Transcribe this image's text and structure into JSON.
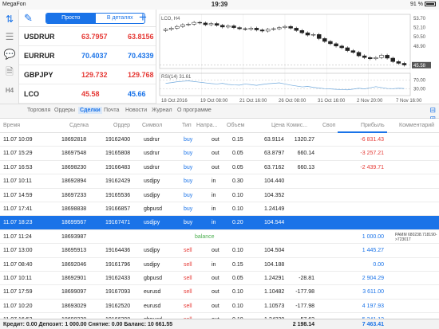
{
  "status": {
    "carrier": "MegaFon",
    "time": "19:39",
    "battery": "91 %"
  },
  "quotes": {
    "tab_simple": "Просто",
    "tab_detailed": "В деталях",
    "items": [
      {
        "symbol": "USDRUR",
        "bid": "63.7957",
        "ask": "63.8156",
        "bid_color": "#e53935",
        "ask_color": "#e53935"
      },
      {
        "symbol": "EURRUR",
        "bid": "70.4037",
        "ask": "70.4339",
        "bid_color": "#1a73e8",
        "ask_color": "#1a73e8"
      },
      {
        "symbol": "GBPJPY",
        "bid": "129.732",
        "ask": "129.768",
        "bid_color": "#e53935",
        "ask_color": "#e53935"
      },
      {
        "symbol": "LCO",
        "bid": "45.58",
        "ask": "45.66",
        "bid_color": "#e53935",
        "ask_color": "#1a73e8"
      }
    ]
  },
  "chart": {
    "title": "LCO, H4",
    "rsi_label": "RSI(14) 31.61",
    "price_ticks": [
      "53.70",
      "52.10",
      "50.50",
      "48.90"
    ],
    "current_price": "45.58",
    "rsi_ticks": [
      "70.00",
      "30.00"
    ],
    "time_ticks": [
      "18 Oct 2016",
      "19 Oct 08:00",
      "21 Oct 16:00",
      "26 Oct 08:00",
      "31 Oct 16:00",
      "2 Nov 20:00",
      "7 Nov 16:00"
    ]
  },
  "chart_data": {
    "type": "candlestick",
    "title": "LCO, H4",
    "close": [
      51.8,
      52.0,
      52.3,
      52.6,
      52.7,
      53.0,
      52.9,
      52.6,
      52.8,
      52.5,
      52.2,
      52.4,
      52.1,
      51.9,
      51.8,
      52.0,
      51.7,
      51.5,
      51.8,
      51.9,
      52.1,
      52.3,
      52.0,
      51.6,
      51.2,
      50.8,
      50.9,
      50.2,
      49.7,
      49.3,
      48.9,
      48.6,
      48.1,
      47.8,
      47.2,
      46.9,
      46.7,
      46.9,
      47.3,
      46.8,
      46.2,
      45.9,
      45.6
    ],
    "rsi": [
      55,
      58,
      62,
      64,
      66,
      63,
      60,
      57,
      54,
      52,
      55,
      50,
      48,
      47,
      52,
      49,
      46,
      50,
      53,
      55,
      57,
      52,
      47,
      43,
      39,
      41,
      37,
      34,
      31,
      30,
      28,
      27,
      26,
      29,
      33,
      30,
      35,
      40,
      36,
      32,
      31,
      33,
      31.6
    ],
    "y_ticks": [
      53.7,
      52.1,
      50.5,
      48.9
    ],
    "rsi_ticks": [
      70,
      30
    ]
  },
  "tabs": [
    "Торговля",
    "Ордеры",
    "Сделки",
    "Почта",
    "Новости",
    "Журнал",
    "О программе"
  ],
  "columns": [
    "Время",
    "Сделка",
    "Ордер",
    "Символ",
    "Тип",
    "Напра...",
    "Объем",
    "Цена",
    "Комис...",
    "Своп",
    "Прибыль",
    "Комментарий"
  ],
  "deals": [
    {
      "time": "11.07 10:09",
      "deal": "18692818",
      "order": "19162400",
      "symbol": "usdrur",
      "type": "buy",
      "dir": "out",
      "volume": "0.15",
      "price": "63.9114",
      "swap": "1320.27",
      "profit": "-6 831.43",
      "profit_class": "neg",
      "comment": ""
    },
    {
      "time": "11.07 15:29",
      "deal": "18697548",
      "order": "19165808",
      "symbol": "usdrur",
      "type": "buy",
      "dir": "out",
      "volume": "0.05",
      "price": "63.8797",
      "swap": "660.14",
      "profit": "-3 257.21",
      "profit_class": "neg",
      "comment": ""
    },
    {
      "time": "11.07 16:53",
      "deal": "18698230",
      "order": "19166483",
      "symbol": "usdrur",
      "type": "buy",
      "dir": "out",
      "volume": "0.05",
      "price": "63.7162",
      "swap": "660.13",
      "profit": "-2 439.71",
      "profit_class": "neg",
      "comment": ""
    },
    {
      "time": "11.07 10:11",
      "deal": "18692894",
      "order": "19162429",
      "symbol": "usdjpy",
      "type": "buy",
      "dir": "in",
      "volume": "0.30",
      "price": "104.440",
      "swap": "",
      "profit": "",
      "profit_class": "",
      "comment": ""
    },
    {
      "time": "11.07 14:59",
      "deal": "18697233",
      "order": "19165536",
      "symbol": "usdjpy",
      "type": "buy",
      "dir": "in",
      "volume": "0.10",
      "price": "104.352",
      "swap": "",
      "profit": "",
      "profit_class": "",
      "comment": ""
    },
    {
      "time": "11.07 17:41",
      "deal": "18698838",
      "order": "19166857",
      "symbol": "gbpusd",
      "type": "buy",
      "dir": "in",
      "volume": "0.10",
      "price": "1.24149",
      "swap": "",
      "profit": "",
      "profit_class": "",
      "comment": ""
    },
    {
      "time": "11.07 18:23",
      "deal": "18699567",
      "order": "19167471",
      "symbol": "usdjpy",
      "type": "buy",
      "dir": "in",
      "volume": "0.20",
      "price": "104.544",
      "swap": "",
      "profit": "",
      "profit_class": "",
      "comment": "",
      "selected": true
    },
    {
      "time": "11.07 11:24",
      "deal": "18693987",
      "order": "",
      "symbol": "",
      "type": "balance",
      "dir": "",
      "volume": "",
      "price": "",
      "swap": "",
      "profit": "1 000.00",
      "profit_class": "pos",
      "comment": "PAMM 680238.718190->723017"
    },
    {
      "time": "11.07 13:00",
      "deal": "18695913",
      "order": "19164436",
      "symbol": "usdjpy",
      "type": "sell",
      "dir": "out",
      "volume": "0.10",
      "price": "104.504",
      "swap": "",
      "profit": "1 445.27",
      "profit_class": "pos",
      "comment": ""
    },
    {
      "time": "11.07 08:40",
      "deal": "18692046",
      "order": "19161796",
      "symbol": "usdjpy",
      "type": "sell",
      "dir": "in",
      "volume": "0.15",
      "price": "104.188",
      "swap": "",
      "profit": "0.00",
      "profit_class": "pos",
      "comment": ""
    },
    {
      "time": "11.07 10:11",
      "deal": "18692901",
      "order": "19162433",
      "symbol": "gbpusd",
      "type": "sell",
      "dir": "out",
      "volume": "0.05",
      "price": "1.24291",
      "swap": "-28.81",
      "profit": "2 904.29",
      "profit_class": "pos",
      "comment": ""
    },
    {
      "time": "11.07 17:59",
      "deal": "18699097",
      "order": "19167093",
      "symbol": "eurusd",
      "type": "sell",
      "dir": "out",
      "volume": "0.10",
      "price": "1.10482",
      "swap": "-177.98",
      "profit": "3 611.00",
      "profit_class": "pos",
      "comment": ""
    },
    {
      "time": "11.07 10:20",
      "deal": "18693029",
      "order": "19162520",
      "symbol": "eurusd",
      "type": "sell",
      "dir": "out",
      "volume": "0.10",
      "price": "1.10573",
      "swap": "-177.98",
      "profit": "4 197.93",
      "profit_class": "pos",
      "comment": ""
    },
    {
      "time": "11.07 16:53",
      "deal": "18698238",
      "order": "19166398",
      "symbol": "gbpusd",
      "type": "sell",
      "dir": "out",
      "volume": "0.10",
      "price": "1.24220",
      "swap": "-57.62",
      "profit": "5 341.12",
      "profit_class": "pos",
      "comment": ""
    }
  ],
  "footer": {
    "summary": "Кредит: 0.00  Депозит: 1 000.00  Снятие: 0.00  Баланс: 10 661.55",
    "swap_total": "2 198.14",
    "profit_total": "7 463.41"
  }
}
